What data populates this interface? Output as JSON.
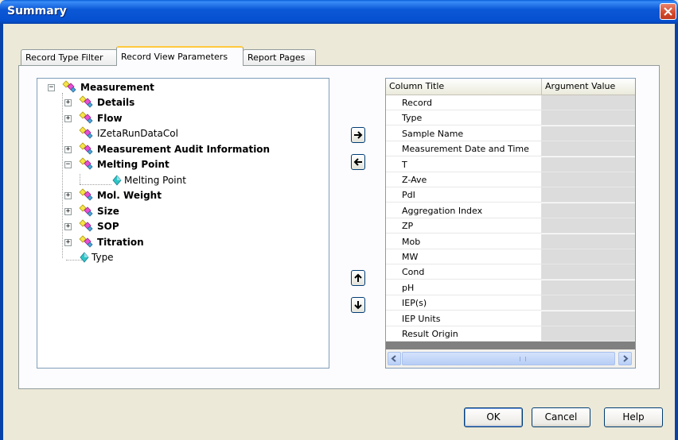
{
  "window": {
    "title": "Summary"
  },
  "tabs": [
    {
      "label": "Record Type Filter",
      "active": false
    },
    {
      "label": "Record View Parameters",
      "active": true
    },
    {
      "label": "Report Pages",
      "active": false
    }
  ],
  "tree": {
    "root": "Measurement",
    "items": [
      {
        "label": "Details",
        "bold": true,
        "expandable": true
      },
      {
        "label": "Flow",
        "bold": true,
        "expandable": true
      },
      {
        "label": "IZetaRunDataCol",
        "bold": false,
        "expandable": false
      },
      {
        "label": "Measurement Audit Information",
        "bold": true,
        "expandable": true
      },
      {
        "label": "Melting Point",
        "bold": true,
        "expandable": true,
        "expanded": true
      },
      {
        "label": "Melting Point",
        "bold": false,
        "child": true
      },
      {
        "label": "Mol. Weight",
        "bold": true,
        "expandable": true
      },
      {
        "label": "Size",
        "bold": true,
        "expandable": true
      },
      {
        "label": "SOP",
        "bold": true,
        "expandable": true
      },
      {
        "label": "Titration",
        "bold": true,
        "expandable": true
      },
      {
        "label": "Type",
        "bold": false,
        "leaf": true
      }
    ]
  },
  "grid": {
    "headers": {
      "column_title": "Column Title",
      "argument_value": "Argument Value"
    },
    "rows": [
      "Record",
      "Type",
      "Sample Name",
      "Measurement Date and Time",
      "T",
      "Z-Ave",
      "PdI",
      "Aggregation Index",
      "ZP",
      "Mob",
      "MW",
      "Cond",
      "pH",
      "IEP(s)",
      "IEP Units",
      "Result Origin"
    ],
    "scrollbar_grip": "III"
  },
  "buttons": {
    "ok": "OK",
    "cancel": "Cancel",
    "help": "Help"
  },
  "colors": {
    "titlebar": "#0550d0",
    "close": "#d4472b",
    "dialog_bg": "#ece9d8",
    "tab_highlight": "#ffc83c"
  },
  "icons": {
    "close": "close-icon",
    "arrow_right": "arrow-right-icon",
    "arrow_left": "arrow-left-icon",
    "arrow_up": "arrow-up-icon",
    "arrow_down": "arrow-down-icon",
    "group": "group-node-icon",
    "field": "field-icon"
  }
}
